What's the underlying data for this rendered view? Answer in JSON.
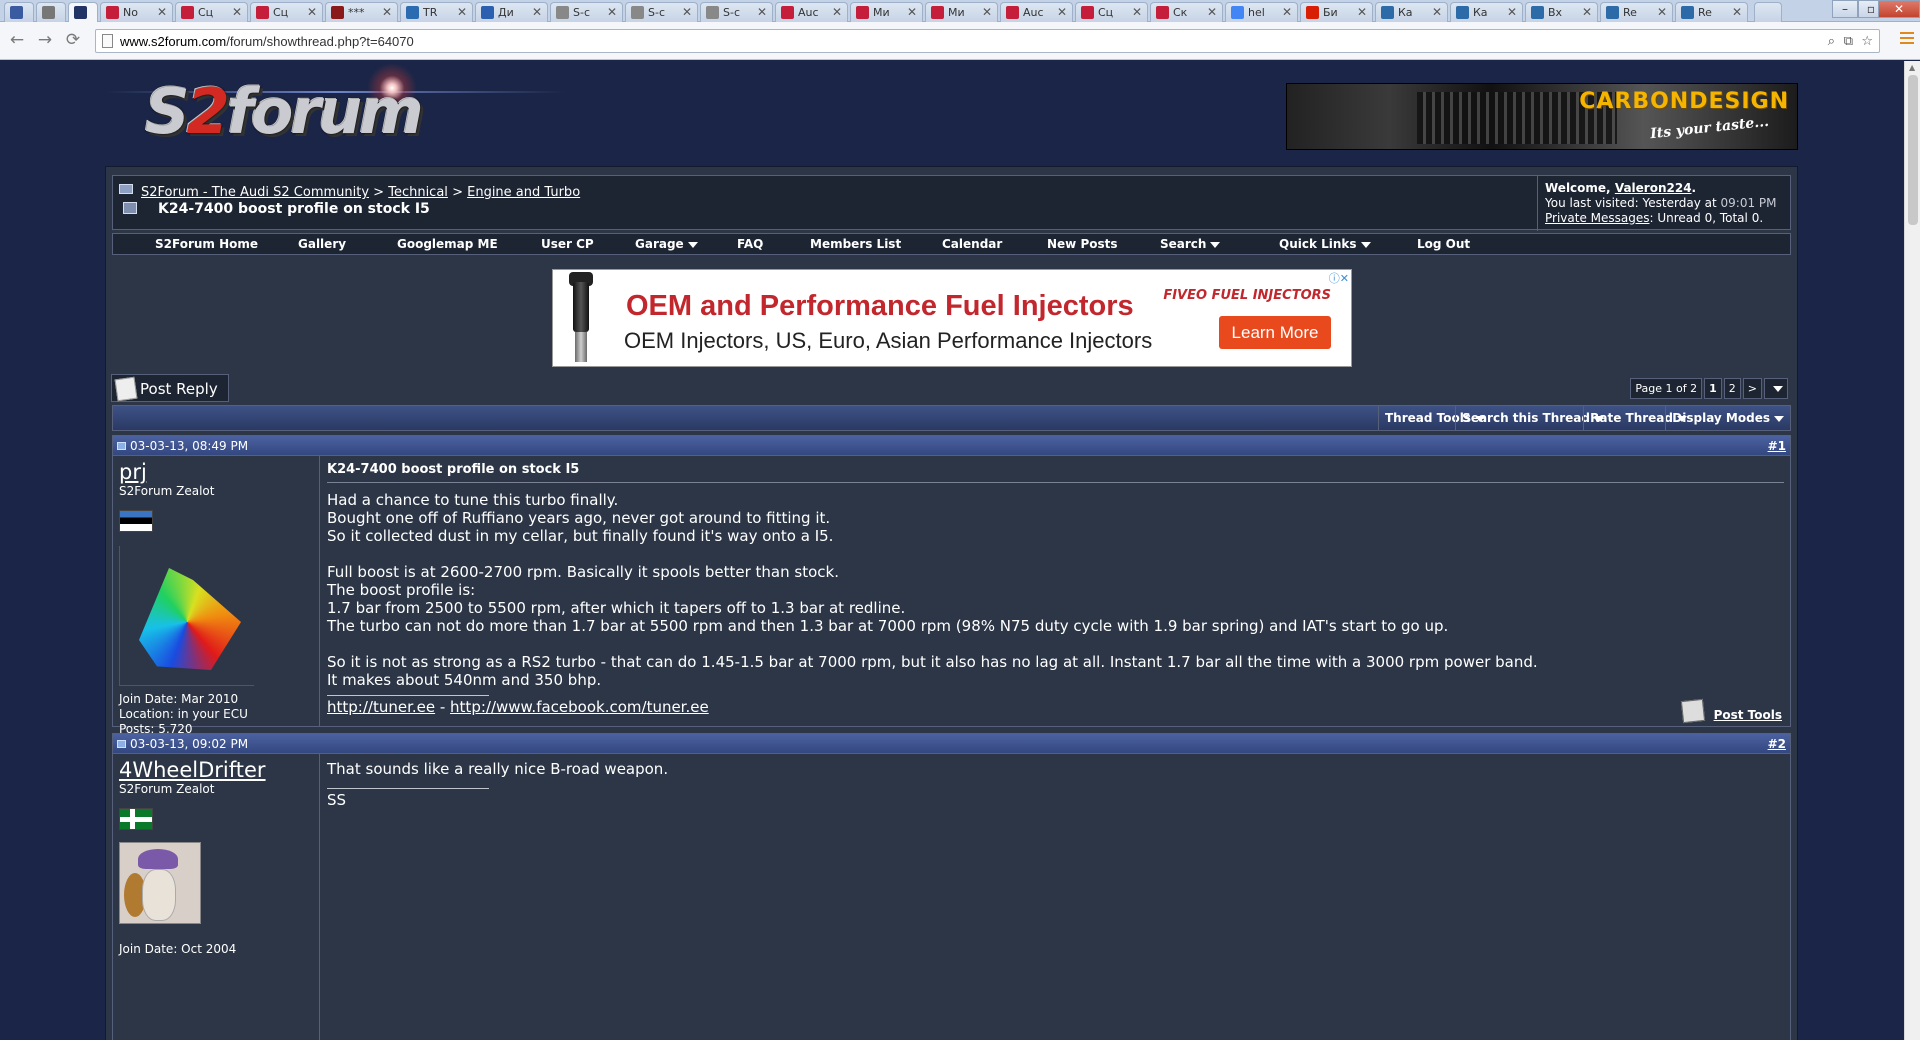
{
  "browser": {
    "tabs": [
      {
        "icon": "pinned-app-icon",
        "title": "",
        "color": "#3a5ba0"
      },
      {
        "icon": "settings-icon",
        "title": "",
        "color": "#777777"
      },
      {
        "icon": "site-favicon",
        "title": "",
        "color": "#223366"
      },
      {
        "icon": "d-favicon",
        "title": "No",
        "color": "#c41e3a"
      },
      {
        "icon": "d-favicon",
        "title": "Сц",
        "color": "#c41e3a"
      },
      {
        "icon": "d-favicon",
        "title": "Сц",
        "color": "#c41e3a"
      },
      {
        "icon": "flag-favicon",
        "title": "***",
        "color": "#8a1a1a"
      },
      {
        "icon": "trello-favicon",
        "title": "TR",
        "color": "#2b6cb0"
      },
      {
        "icon": "window-favicon",
        "title": "Ди",
        "color": "#2b5fb0"
      },
      {
        "icon": "page-favicon",
        "title": "S-c",
        "color": "#888888"
      },
      {
        "icon": "page-favicon",
        "title": "S-c",
        "color": "#888888"
      },
      {
        "icon": "page-favicon",
        "title": "S-c",
        "color": "#888888"
      },
      {
        "icon": "d-favicon",
        "title": "Auc",
        "color": "#c41e3a"
      },
      {
        "icon": "d-favicon",
        "title": "Ми",
        "color": "#c41e3a"
      },
      {
        "icon": "d-favicon",
        "title": "Ми",
        "color": "#c41e3a"
      },
      {
        "icon": "d-favicon",
        "title": "Auc",
        "color": "#c41e3a"
      },
      {
        "icon": "d-favicon",
        "title": "Сц",
        "color": "#c41e3a"
      },
      {
        "icon": "d-favicon",
        "title": "Ск",
        "color": "#c41e3a"
      },
      {
        "icon": "google-favicon",
        "title": "hel",
        "color": "#4285f4"
      },
      {
        "icon": "e1-favicon",
        "title": "Би",
        "color": "#d81e05"
      },
      {
        "icon": "v-favicon",
        "title": "Ка",
        "color": "#2c6aa8"
      },
      {
        "icon": "v-favicon",
        "title": "Ка",
        "color": "#2c6aa8"
      },
      {
        "icon": "v-favicon",
        "title": "Вх",
        "color": "#2c6aa8"
      },
      {
        "icon": "v-favicon",
        "title": "Re",
        "color": "#2c6aa8"
      },
      {
        "icon": "v-favicon",
        "title": "Re",
        "color": "#2c6aa8"
      }
    ],
    "url_host": "www.s2forum.com",
    "url_path": "/forum/showthread.php?t=64070"
  },
  "header": {
    "logo_main": "S",
    "logo_two": "2",
    "logo_rest": "forum",
    "banner_brand": "CARBONDESIGN",
    "banner_slogan": "Its your taste..."
  },
  "breadcrumb": {
    "items": [
      "S2Forum - The Audi S2 Community",
      "Technical",
      "Engine and Turbo"
    ],
    "separator": ">",
    "thread_title": "K24-7400 boost profile on stock I5"
  },
  "welcome": {
    "greeting": "Welcome,",
    "username": "Valeron224",
    "last_visited_label": "You last visited: Yesterday at",
    "last_visited_time": "09:01 PM",
    "pm_link": "Private Messages",
    "pm_stats": ": Unread 0, Total 0."
  },
  "menubar": {
    "items": [
      {
        "label": "S2Forum Home",
        "dropdown": false
      },
      {
        "label": "Gallery",
        "dropdown": false
      },
      {
        "label": "Googlemap ME",
        "dropdown": false
      },
      {
        "label": "User CP",
        "dropdown": false
      },
      {
        "label": "Garage",
        "dropdown": true
      },
      {
        "label": "FAQ",
        "dropdown": false
      },
      {
        "label": "Members List",
        "dropdown": false
      },
      {
        "label": "Calendar",
        "dropdown": false
      },
      {
        "label": "New Posts",
        "dropdown": false
      },
      {
        "label": "Search",
        "dropdown": true
      },
      {
        "label": "Quick Links",
        "dropdown": true
      },
      {
        "label": "Log Out",
        "dropdown": false
      }
    ]
  },
  "ad": {
    "headline": "OEM and Performance Fuel Injectors",
    "subline": "OEM Injectors, US, Euro, Asian Performance Injectors",
    "brand_a": "FIVEO",
    "brand_b": "FUEL INJECTORS",
    "cta": "Learn More",
    "choices": "ⓘ✕"
  },
  "thread": {
    "post_reply_label": "Post Reply",
    "page_info": "Page 1 of 2",
    "pages": [
      "1",
      "2"
    ],
    "next": ">",
    "tools": [
      "Thread Tools",
      "Search this Thread",
      "Rate Thread",
      "Display Modes"
    ]
  },
  "posts": [
    {
      "date": "03-03-13, 08:49 PM",
      "number": "#1",
      "username": "prj",
      "usertitle": "S2Forum Zealot",
      "join": "Join Date: Mar 2010",
      "location": "Location: in your ECU",
      "posts": "Posts: 5,720",
      "title": "K24-7400 boost profile on stock I5",
      "lines": [
        "Had a chance to tune this turbo finally.",
        "Bought one off of Ruffiano years ago, never got around to fitting it.",
        "So it collected dust in my cellar, but finally found it's way onto a I5.",
        "",
        "Full boost is at 2600-2700 rpm. Basically it spools better than stock.",
        "The boost profile is:",
        "1.7 bar from 2500 to 5500 rpm, after which it tapers off to 1.3 bar at redline.",
        "The turbo can not do more than 1.7 bar at 5500 rpm and then 1.3 bar at 7000 rpm (98% N75 duty cycle with 1.9 bar spring) and IAT's start to go up.",
        "",
        "So it is not as strong as a RS2 turbo - that can do 1.45-1.5 bar at 7000 rpm, but it also has no lag at all. Instant 1.7 bar all the time with a 3000 rpm power band.",
        "It makes about 540nm and 350 bhp."
      ],
      "sig_link1": "http://tuner.ee",
      "sig_sep": " - ",
      "sig_link2": "http://www.facebook.com/tuner.ee",
      "post_tools": "Post Tools"
    },
    {
      "date": "03-03-13, 09:02 PM",
      "number": "#2",
      "username": "4WheelDrifter",
      "usertitle": "S2Forum Zealot",
      "join": "Join Date: Oct 2004",
      "lines": [
        "That sounds like a really nice B-road weapon."
      ],
      "sig": "SS"
    }
  ]
}
